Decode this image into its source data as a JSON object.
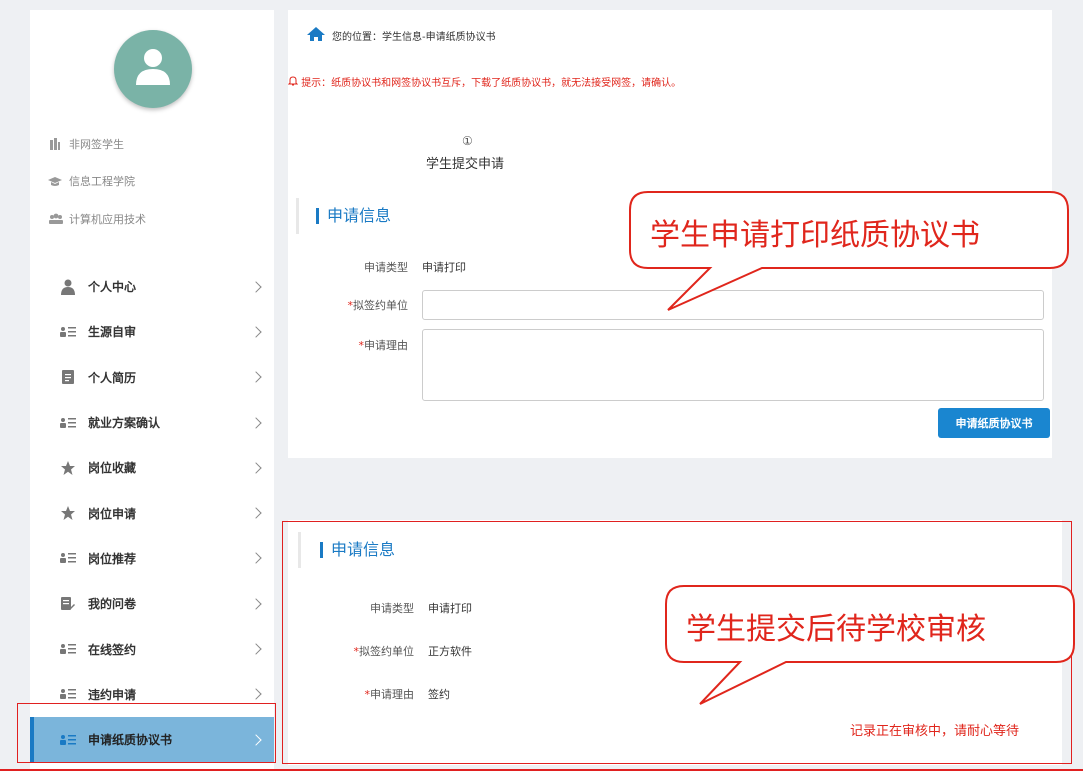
{
  "sidebar": {
    "student_type": "非网签学生",
    "college": "信息工程学院",
    "major": "计算机应用技术",
    "items": [
      {
        "label": "个人中心",
        "icon": "person-icon"
      },
      {
        "label": "生源自审",
        "icon": "list-icon"
      },
      {
        "label": "个人简历",
        "icon": "document-icon"
      },
      {
        "label": "就业方案确认",
        "icon": "list-icon"
      },
      {
        "label": "岗位收藏",
        "icon": "star-icon"
      },
      {
        "label": "岗位申请",
        "icon": "star-icon"
      },
      {
        "label": "岗位推荐",
        "icon": "list-icon"
      },
      {
        "label": "我的问卷",
        "icon": "survey-icon"
      },
      {
        "label": "在线签约",
        "icon": "list-icon"
      },
      {
        "label": "违约申请",
        "icon": "list-icon"
      },
      {
        "label": "申请纸质协议书",
        "icon": "list-icon"
      }
    ],
    "active_index": 10
  },
  "breadcrumb": "您的位置：学生信息-申请纸质协议书",
  "tip": "提示：纸质协议书和网签协议书互斥，下载了纸质协议书，就无法接受网签，请确认。",
  "step": {
    "number": "①",
    "label": "学生提交申请"
  },
  "form1": {
    "section_title": "申请信息",
    "type_label": "申请类型",
    "type_value": "申请打印",
    "unit_label": "拟签约单位",
    "reason_label": "申请理由",
    "unit_value": "",
    "reason_value": "",
    "submit_label": "申请纸质协议书"
  },
  "form2": {
    "section_title": "申请信息",
    "type_label": "申请类型",
    "type_value": "申请打印",
    "unit_label": "拟签约单位",
    "unit_value": "正方软件",
    "reason_label": "申请理由",
    "reason_value": "签约",
    "pending_text": "记录正在审核中，请耐心等待"
  },
  "callouts": {
    "first": "学生申请打印纸质协议书",
    "second": "学生提交后待学校审核"
  },
  "colors": {
    "accent": "#1a7ac4",
    "alert": "#e0261c",
    "avatar": "#7ab3a7",
    "active_bg": "#7bb5db"
  }
}
